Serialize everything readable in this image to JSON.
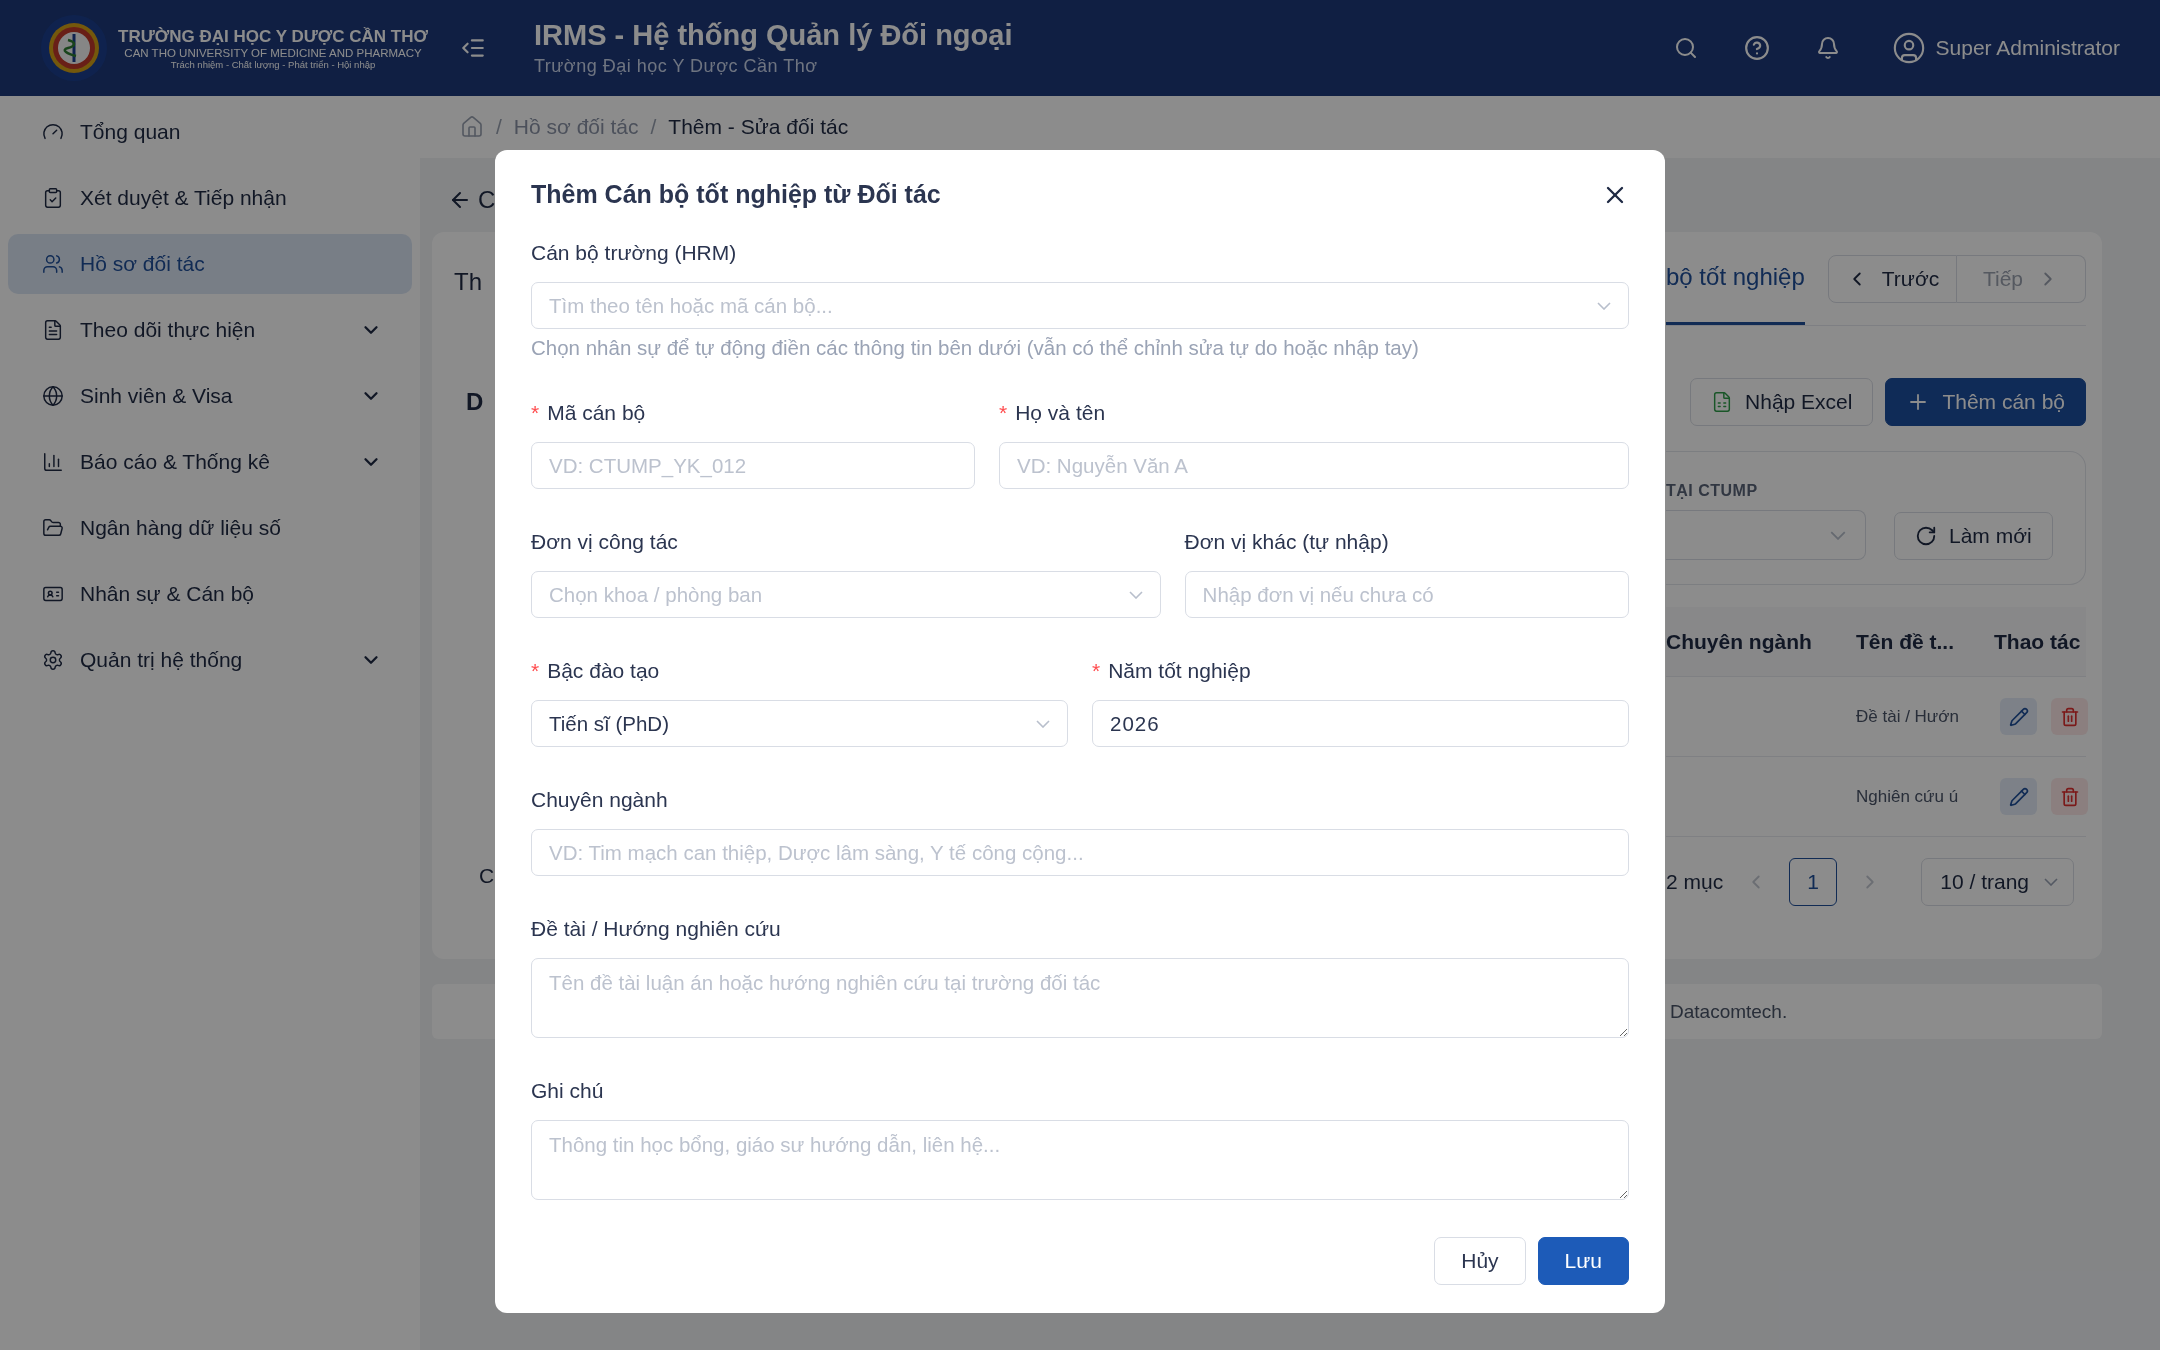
{
  "header": {
    "school_lines": [
      "TRƯỜNG ĐẠI HỌC Y DƯỢC CẦN THƠ",
      "CAN THO UNIVERSITY OF MEDICINE AND PHARMACY",
      "Trách nhiệm - Chất lượng - Phát triển - Hội nhập"
    ],
    "app_title": "IRMS - Hệ thống Quản lý Đối ngoại",
    "app_subtitle": "Trường Đại học Y Dược Cần Thơ",
    "user_name": "Super Administrator"
  },
  "sidebar": {
    "items": [
      {
        "label": "Tổng quan",
        "selected": false,
        "expandable": false
      },
      {
        "label": "Xét duyệt & Tiếp nhận",
        "selected": false,
        "expandable": false
      },
      {
        "label": "Hồ sơ đối tác",
        "selected": true,
        "expandable": false
      },
      {
        "label": "Theo dõi thực hiện",
        "selected": false,
        "expandable": true
      },
      {
        "label": "Sinh viên & Visa",
        "selected": false,
        "expandable": true
      },
      {
        "label": "Báo cáo & Thống kê",
        "selected": false,
        "expandable": true
      },
      {
        "label": "Ngân hàng dữ liệu số",
        "selected": false,
        "expandable": false
      },
      {
        "label": "Nhân sự & Cán bộ",
        "selected": false,
        "expandable": false
      },
      {
        "label": "Quản trị hệ thống",
        "selected": false,
        "expandable": true
      }
    ]
  },
  "breadcrumb": {
    "separator": "/",
    "items": [
      "Hồ sơ đối tác",
      "Thêm - Sửa đối tác"
    ]
  },
  "background": {
    "back_title": "C",
    "left_tab": "Th",
    "section_heading": "D",
    "pagination_text": "C",
    "tab": {
      "label": "bộ tốt nghiệp",
      "selected": true
    },
    "pager": [
      {
        "label": "Trước",
        "disabled": false
      },
      {
        "label": "Tiếp",
        "disabled": true
      }
    ],
    "actions": [
      {
        "label": "Nhập Excel",
        "kind": "excel"
      },
      {
        "label": "Thêm cán bộ",
        "kind": "primary"
      }
    ],
    "filter_label": "TẠI CTUMP",
    "refresh": "Làm mới",
    "table": {
      "columns": [
        "Chuyên ngành",
        "Tên đề t...",
        "Thao tác"
      ],
      "rows": [
        {
          "topic": "Đề tài / Hướn"
        },
        {
          "topic": "Nghiên cứu ú"
        }
      ]
    },
    "pagination": {
      "total": "2 mục",
      "pages": [
        {
          "label": "1",
          "selected": true
        }
      ],
      "page_size": "10 / trang"
    },
    "footer": "Datacomtech."
  },
  "modal": {
    "title": "Thêm Cán bộ tốt nghiệp từ Đối tác",
    "required_mark": "*",
    "rows": [
      [
        {
          "label": "Cán bộ trường (HRM)",
          "kind": "select",
          "required": false,
          "placeholder": "Tìm theo tên hoặc mã cán bộ...",
          "help": "Chọn nhân sự để tự động điền các thông tin bên dưới (vẫn có thể chỉnh sửa tự do hoặc nhập tay)"
        }
      ],
      [
        {
          "label": "Mã cán bộ",
          "kind": "input",
          "required": true,
          "placeholder": "VD: CTUMP_YK_012"
        },
        {
          "label": "Họ và tên",
          "kind": "input",
          "required": true,
          "placeholder": "VD: Nguyễn Văn A"
        }
      ],
      [
        {
          "label": "Đơn vị công tác",
          "kind": "select",
          "required": false,
          "placeholder": "Chọn khoa / phòng ban"
        },
        {
          "label": "Đơn vị khác (tự nhập)",
          "kind": "input",
          "required": false,
          "placeholder": "Nhập đơn vị nếu chưa có"
        }
      ],
      [
        {
          "label": "Bậc đào tạo",
          "kind": "select",
          "required": true,
          "value": "Tiến sĩ (PhD)"
        },
        {
          "label": "Năm tốt nghiệp",
          "kind": "input",
          "required": true,
          "value": "2026"
        }
      ],
      [
        {
          "label": "Chuyên ngành",
          "kind": "input",
          "required": false,
          "placeholder": "VD: Tim mạch can thiệp, Dược lâm sàng, Y tế công cộng..."
        }
      ],
      [
        {
          "label": "Đề tài / Hướng nghiên cứu",
          "kind": "textarea",
          "required": false,
          "placeholder": "Tên đề tài luận án hoặc hướng nghiên cứu tại trường đối tác"
        }
      ],
      [
        {
          "label": "Ghi chú",
          "kind": "textarea",
          "required": false,
          "placeholder": "Thông tin học bổng, giáo sư hướng dẫn, liên hệ..."
        }
      ]
    ],
    "buttons": [
      {
        "label": "Hủy",
        "kind": "default"
      },
      {
        "label": "Lưu",
        "kind": "primary"
      }
    ]
  }
}
